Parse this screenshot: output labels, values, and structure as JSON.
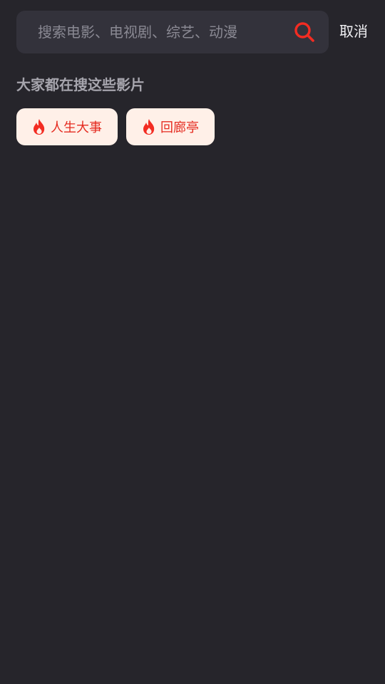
{
  "search": {
    "placeholder": "搜索电影、电视剧、综艺、动漫",
    "value": "",
    "cancel_label": "取消"
  },
  "hot_section": {
    "title": "大家都在搜这些影片",
    "items": [
      {
        "label": "人生大事",
        "icon": "flame-icon"
      },
      {
        "label": "回廊亭",
        "icon": "flame-icon"
      }
    ]
  },
  "colors": {
    "background": "#26252b",
    "search_bar": "#33323b",
    "accent_red": "#e52b20",
    "tag_background": "#fff0e8"
  }
}
